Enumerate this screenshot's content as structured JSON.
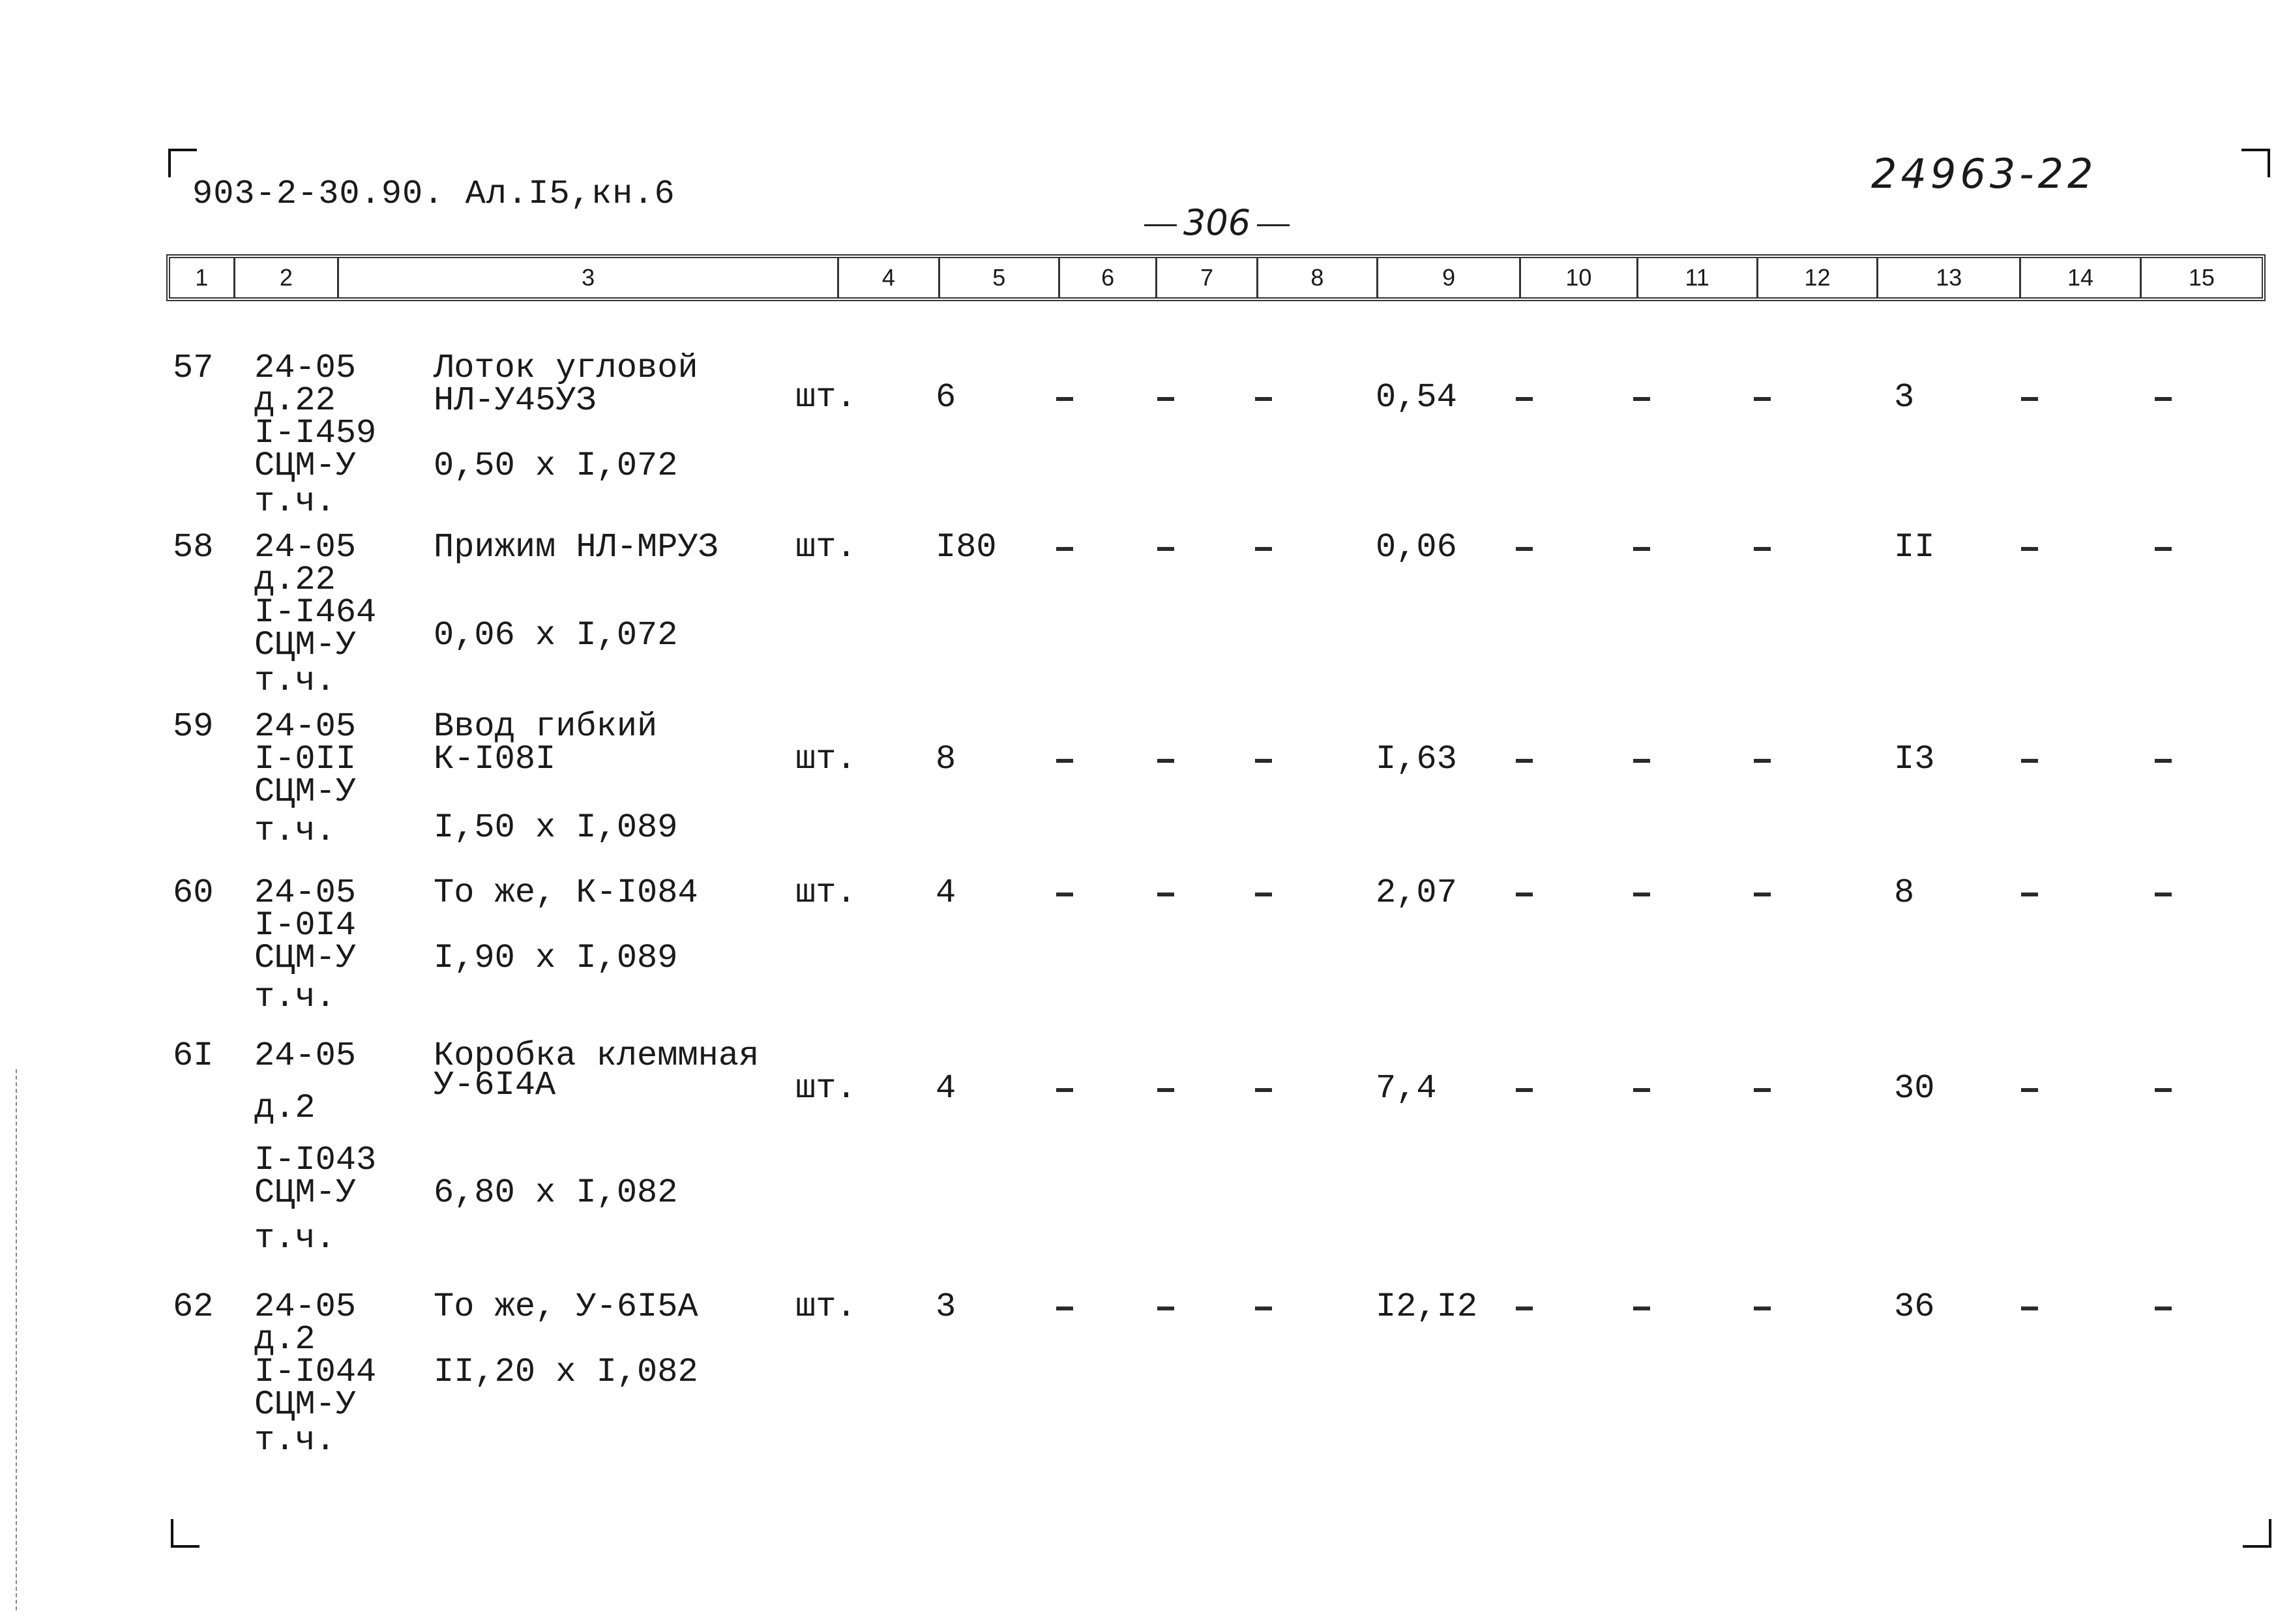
{
  "header": {
    "doc_code": "903-2-30.90. Ал.I5,кн.6",
    "page_number": "306",
    "archive_number": "24963-22"
  },
  "columns": [
    "1",
    "2",
    "3",
    "4",
    "5",
    "6",
    "7",
    "8",
    "9",
    "10",
    "11",
    "12",
    "13",
    "14",
    "15"
  ],
  "rows": [
    {
      "no": "57",
      "code": [
        "24-05",
        "д.22",
        "I-I459",
        "СЦМ-У",
        "т.ч."
      ],
      "name": [
        "Лоток угловой",
        "НЛ-У45УЗ"
      ],
      "formula": "0,50 x I,072",
      "unit": "шт.",
      "qty": "6",
      "c6": "-",
      "c7": "-",
      "c8": "-",
      "c9": "0,54",
      "c10": "-",
      "c11": "-",
      "c12": "-",
      "c13": "3",
      "c14": "-",
      "c15": "-"
    },
    {
      "no": "58",
      "code": [
        "24-05",
        "д.22",
        "I-I464",
        "СЦМ-У",
        "т.ч."
      ],
      "name": [
        "Прижим НЛ-МРУЗ"
      ],
      "formula": "0,06 x I,072",
      "unit": "шт.",
      "qty": "I80",
      "c6": "-",
      "c7": "-",
      "c8": "-",
      "c9": "0,06",
      "c10": "-",
      "c11": "-",
      "c12": "-",
      "c13": "II",
      "c14": "-",
      "c15": "-"
    },
    {
      "no": "59",
      "code": [
        "24-05",
        "I-0II",
        "СЦМ-У",
        "т.ч."
      ],
      "name": [
        "Ввод гибкий",
        "К-I08I"
      ],
      "formula": "I,50 x I,089",
      "unit": "шт.",
      "qty": "8",
      "c6": "-",
      "c7": "-",
      "c8": "-",
      "c9": "I,63",
      "c10": "-",
      "c11": "-",
      "c12": "-",
      "c13": "I3",
      "c14": "-",
      "c15": "-"
    },
    {
      "no": "60",
      "code": [
        "24-05",
        "I-0I4",
        "СЦМ-У",
        "т.ч."
      ],
      "name": [
        "То же, К-I084"
      ],
      "formula": "I,90 x I,089",
      "unit": "шт.",
      "qty": "4",
      "c6": "-",
      "c7": "-",
      "c8": "-",
      "c9": "2,07",
      "c10": "-",
      "c11": "-",
      "c12": "-",
      "c13": "8",
      "c14": "-",
      "c15": "-"
    },
    {
      "no": "6I",
      "code": [
        "24-05",
        "д.2",
        "I-I043",
        "СЦМ-У",
        "т.ч."
      ],
      "name": [
        "Коробка клеммная",
        "У-6I4А"
      ],
      "formula": "6,80 x I,082",
      "unit": "шт.",
      "qty": "4",
      "c6": "-",
      "c7": "-",
      "c8": "-",
      "c9": "7,4",
      "c10": "-",
      "c11": "-",
      "c12": "-",
      "c13": "30",
      "c14": "-",
      "c15": "-"
    },
    {
      "no": "62",
      "code": [
        "24-05",
        "д.2",
        "I-I044",
        "СЦМ-У",
        "т.ч."
      ],
      "name": [
        "То же, У-6I5А"
      ],
      "formula": "II,20 x I,082",
      "unit": "шт.",
      "qty": "3",
      "c6": "-",
      "c7": "-",
      "c8": "-",
      "c9": "I2,I2",
      "c10": "-",
      "c11": "-",
      "c12": "-",
      "c13": "36",
      "c14": "-",
      "c15": "-"
    }
  ]
}
